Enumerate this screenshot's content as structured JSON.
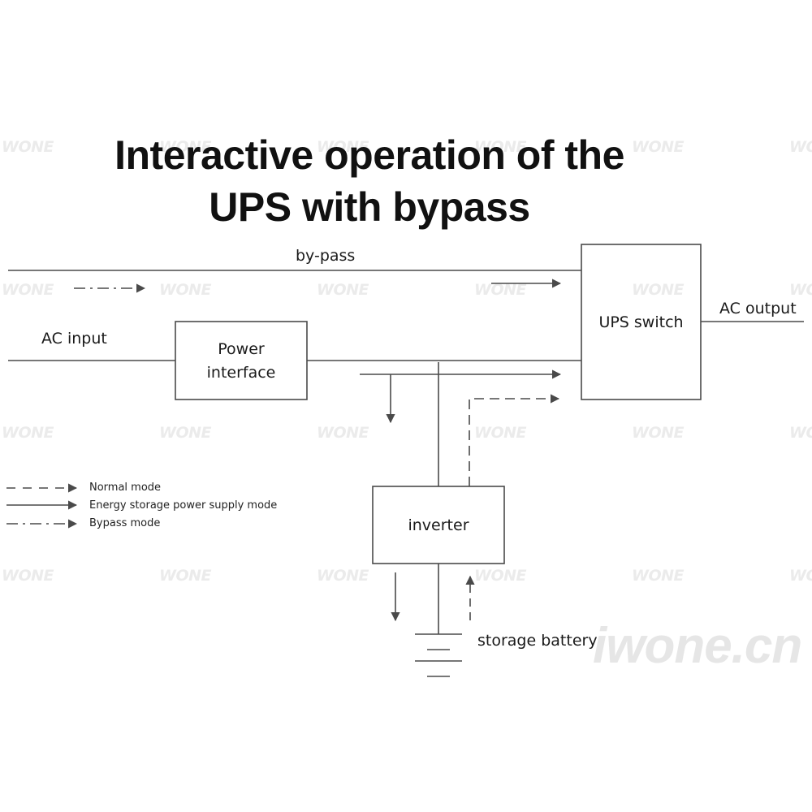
{
  "title": {
    "line1": "Interactive operation of the",
    "line2": "UPS with bypass"
  },
  "blocks": {
    "power_interface": {
      "line1": "Power",
      "line2": "interface"
    },
    "ups_switch": "UPS switch",
    "inverter": "inverter"
  },
  "labels": {
    "bypass_line": "by-pass",
    "ac_input": "AC input",
    "ac_output": "AC output",
    "storage_battery": "storage battery"
  },
  "legend": [
    {
      "style": "dashed",
      "label": "Normal mode"
    },
    {
      "style": "solid",
      "label": "Energy storage power supply mode"
    },
    {
      "style": "dash-dot",
      "label": "Bypass mode"
    }
  ],
  "watermark": {
    "tile_text": "WONE",
    "brand_text": "iwone.cn"
  },
  "colors": {
    "line": "#4a4a4a",
    "text": "#1a1a1a",
    "watermark": "#ebebeb"
  }
}
